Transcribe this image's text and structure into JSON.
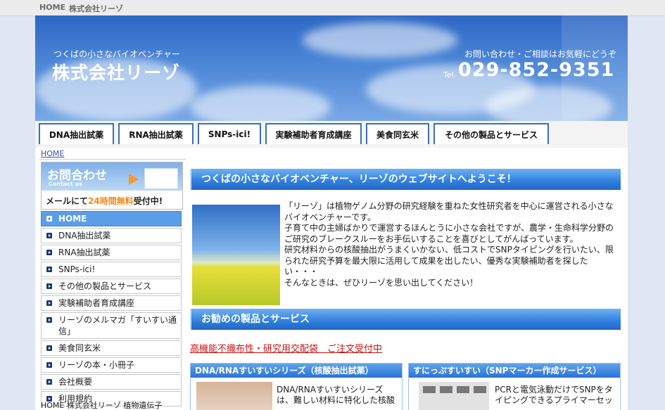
{
  "topbar": {
    "home": "HOME",
    "company": "株式会社リーゾ"
  },
  "header": {
    "tagline": "つくばの小さなバイオベンチャー",
    "company": "株式会社リーゾ",
    "contact_note": "お問い合わせ・ご相談はお気軽にどうぞ",
    "tel_label": "Tel.",
    "tel": "029-852-9351"
  },
  "nav": {
    "tabs": [
      "DNA抽出試薬",
      "RNA抽出試薬",
      "SNPs-ici!",
      "実験補助者育成講座",
      "美食同玄米",
      "その他の製品とサービス"
    ]
  },
  "breadcrumb": "HOME",
  "contact_banner": {
    "title": "お問合わせ",
    "subtitle": "Contact us",
    "line_pre": "メールにて",
    "line_highlight": "24時間無料",
    "line_post": "受付中!"
  },
  "sidebar": {
    "items": [
      {
        "label": "HOME"
      },
      {
        "label": "DNA抽出試薬"
      },
      {
        "label": "RNA抽出試薬"
      },
      {
        "label": "SNPs-ici!"
      },
      {
        "label": "その他の製品とサービス"
      },
      {
        "label": "実験補助者育成講座"
      },
      {
        "label": "リーゾのメルマガ「すいすい通信」"
      },
      {
        "label": "美食同玄米"
      },
      {
        "label": "リーゾの本・小冊子"
      },
      {
        "label": "会社概要"
      },
      {
        "label": "利用規約"
      }
    ],
    "footer": "HOME 株式会社リーゾ 植物遺伝子"
  },
  "main": {
    "welcome_title": "つくばの小さなバイオベンチャー、リーゾのウェブサイトへようこそ！",
    "intro": [
      "「リーゾ」は植物ゲノム分野の研究経験を重ねた女性研究者を中心に運営される小さなバイオベンチャーです。",
      "子育て中の主婦ばかりで運営するほんとうに小さな会社ですが、農学・生命科学分野のご研究のブレークスルーをお手伝いすることを喜びとしてがんばっています。",
      "研究材料からの核酸抽出がうまくいかない、低コストでSNPタイピングを行いたい、限られた研究予算を最大限に活用して成果を出したい、優秀な実験補助者を探したい・・・",
      "そんなときは、ぜひリーゾを思い出してください！"
    ],
    "recommend_title": "お勧めの製品とサービス",
    "order_link": "高機能不織布性・研究用交配袋　ご注文受付中",
    "cards": [
      {
        "title": "DNA/RNAすいすいシリーズ（核酸抽出試薬）",
        "text": "DNA/RNAすいすいシリーズは、難しい材料に特化した核酸"
      },
      {
        "title": "すにっぷすいすい（SNPマーカー作成サービス）",
        "text": "PCRと電気泳動だけでSNPをタイピングできるプライマーセッ"
      }
    ]
  }
}
